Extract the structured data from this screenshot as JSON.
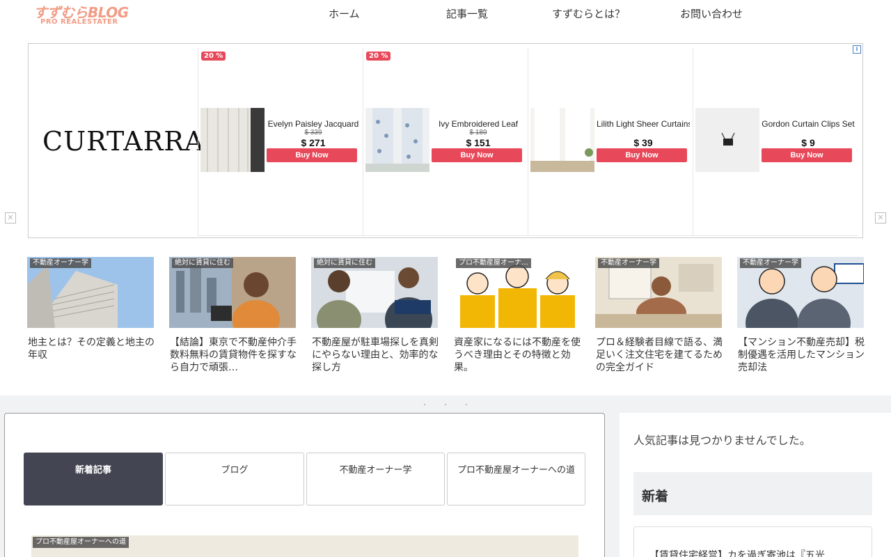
{
  "header": {
    "logo_main": "すずむらBLOG",
    "logo_sub": "PRO REALESTATER",
    "nav": [
      "ホーム",
      "記事一覧",
      "すずむらとは？",
      "お問い合わせ"
    ]
  },
  "ad": {
    "brand": "CURTARRA",
    "info_icon": "i",
    "close_icon": "✕",
    "products": [
      {
        "badge": "20 %",
        "name": "Evelyn Paisley Jacquard",
        "old_price": "$ 339",
        "price": "$ 271",
        "cta": "Buy Now"
      },
      {
        "badge": "20 %",
        "name": "Ivy Embroidered Leaf",
        "old_price": "$ 189",
        "price": "$ 151",
        "cta": "Buy Now"
      },
      {
        "badge": "",
        "name": "Lilith Light Sheer Curtains",
        "old_price": "",
        "price": "$ 39",
        "cta": "Buy Now"
      },
      {
        "badge": "",
        "name": "Gordon Curtain Clips Set",
        "old_price": "",
        "price": "$ 9",
        "cta": "Buy Now"
      }
    ]
  },
  "cards": [
    {
      "category": "不動産オーナー学",
      "title": "地主とは？その定義と地主の年収"
    },
    {
      "category": "絶対に賃貸に住む",
      "title": "【結論】東京で不動産仲介手数料無料の賃貸物件を探すなら自力で頑張…"
    },
    {
      "category": "絶対に賃貸に住む",
      "title": "不動産屋が駐車場探しを真剣にやらない理由と、効率的な探し方"
    },
    {
      "category": "プロ不動産屋オーナ…",
      "title": "資産家になるには不動産を使うべき理由とその特徴と効果。"
    },
    {
      "category": "不動産オーナー学",
      "title": "プロ＆経験者目線で語る、満足いく注文住宅を建てるための完全ガイド"
    },
    {
      "category": "不動産オーナー学",
      "title": "【マンション不動産売却】税制優遇を活用したマンション売却法"
    }
  ],
  "main": {
    "tabs": [
      "新着記事",
      "ブログ",
      "不動産オーナー学",
      "プロ不動産屋オーナーへの道"
    ],
    "feature_category": "プロ不動産屋オーナーへの道"
  },
  "sidebar": {
    "popular_empty": "人気記事は見つかりませんでした。",
    "new_heading": "新着",
    "first_post_partial": "【賃貸住宅経営】カを過ぎ寄池は『五光"
  },
  "colors": {
    "accent": "#e8495a",
    "tab_active": "#434552",
    "logo": "#f19c85"
  }
}
